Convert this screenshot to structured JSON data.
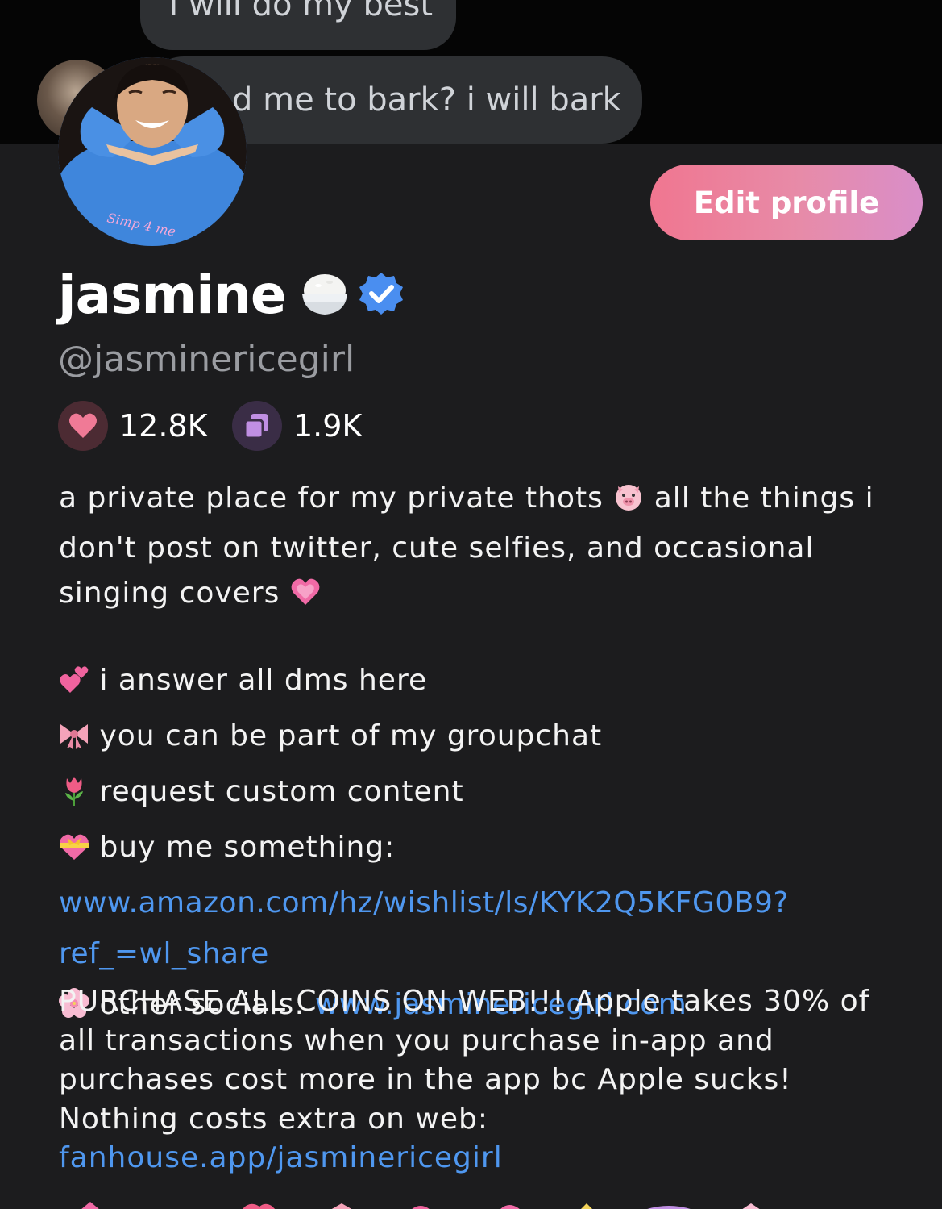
{
  "messages": [
    {
      "text": "i will do my best"
    },
    {
      "text": "d me to bark? i will bark"
    }
  ],
  "profile": {
    "edit_label": "Edit profile",
    "name": "jasmine",
    "handle": "@jasminericegirl",
    "verified": true,
    "likes": "12.8K",
    "posts": "1.9K",
    "avatar_caption": "Simp 4 me"
  },
  "bio": {
    "intro": {
      "part1": "a private place for my private thots ",
      "pig_emoji": "pig-face-emoji",
      "part2": " all the things i don't post on twitter, cute selfies, and occasional singing covers ",
      "heart_emoji": "growing-heart-emoji"
    },
    "items": [
      {
        "emoji": "two-hearts-emoji",
        "text": "i answer all dms here"
      },
      {
        "emoji": "ribbon-emoji",
        "text": "you can be part of my groupchat"
      },
      {
        "emoji": "tulip-emoji",
        "text": "request custom content"
      },
      {
        "emoji": "heart-with-ribbon-emoji",
        "text": "buy me something: ",
        "link": "www.amazon.com/hz/wishlist/ls/KYK2Q5KFG0B9?ref_=wl_share"
      },
      {
        "emoji": "cherry-blossom-emoji",
        "text": "other socials: ",
        "link": "www.jasminericegirl.com"
      }
    ],
    "purchase_text": "PURCHASE ALL COINS ON WEB!!! Apple takes 30% of all transactions when you purchase in-app and purchases cost more in the app bc Apple sucks! Nothing costs extra on web: ",
    "purchase_link": "fanhouse.app/jasminericegirl"
  },
  "colors": {
    "background": "#1c1c1e",
    "link": "#4f97ef",
    "handle": "#9a9ca1",
    "button_gradient_start": "#f07690",
    "button_gradient_end": "#d98ec9",
    "verified": "#4a8ef0",
    "likes_icon": "#f07a96",
    "posts_icon": "#c08fe3"
  }
}
